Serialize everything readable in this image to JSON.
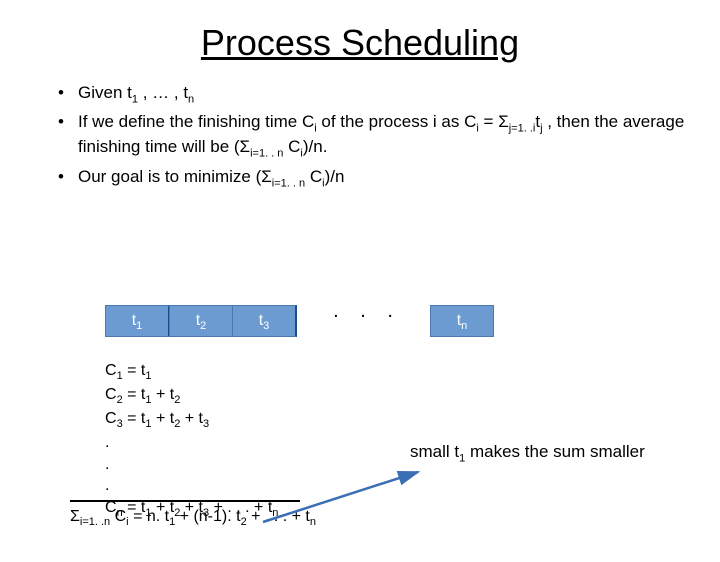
{
  "title": "Process Scheduling",
  "bullets": {
    "b1": {
      "pre": "Given t",
      "sub1": "1",
      "mid": " , … , t",
      "sub2": "n"
    },
    "b2": {
      "p1": "If we define the finishing time C",
      "s1": "i",
      "p2": " of the process i as C",
      "s2": "i",
      "p3": " = Σ",
      "s3": "j=1. .i",
      "p4": "t",
      "s4": "j",
      "p5": " , then the average finishing time will be  (Σ",
      "s5": "i=1. . n",
      "p6": " C",
      "s6": "i",
      "p7": ")/n."
    },
    "b3": {
      "p1": "Our goal is to minimize (Σ",
      "s1": "i=1. . n",
      "p2": " C",
      "s2": "i",
      "p3": ")/n"
    }
  },
  "boxes": {
    "t1": {
      "t": "t",
      "s": "1"
    },
    "t2": {
      "t": "t",
      "s": "2"
    },
    "t3": {
      "t": "t",
      "s": "3"
    },
    "tn": {
      "t": "t",
      "s": "n"
    },
    "dots": ". . ."
  },
  "calc": {
    "l1": {
      "a": "C",
      "as": "1",
      "b": " = t",
      "bs": "1"
    },
    "l2": {
      "a": "C",
      "as": "2",
      "b": " = t",
      "bs": "1",
      "c": " + t",
      "cs": "2"
    },
    "l3": {
      "a": "C",
      "as": "3",
      "b": " = t",
      "bs": "1",
      "c": " + t",
      "cs": "2",
      "d": " + t",
      "ds": "3"
    },
    "doth": ".",
    "ln": {
      "a": "C",
      "as": "n",
      "b": " = t",
      "bs": "1",
      "c": " + t",
      "cs": "2",
      "d": " + t",
      "ds": "3",
      "e": " + . . . + t",
      "es": "n"
    }
  },
  "sum": {
    "p1": "Σ",
    "s1": "i=1. .n",
    "p2": " C",
    "s2": "i",
    "p3": " = n. t",
    "s3": "1",
    "p4": " + (n-1). t",
    "s4": "2",
    "p5": " + . . . + t",
    "s5": "n"
  },
  "note": {
    "p1": "small t",
    "s1": "1",
    "p2": " makes the sum smaller"
  }
}
